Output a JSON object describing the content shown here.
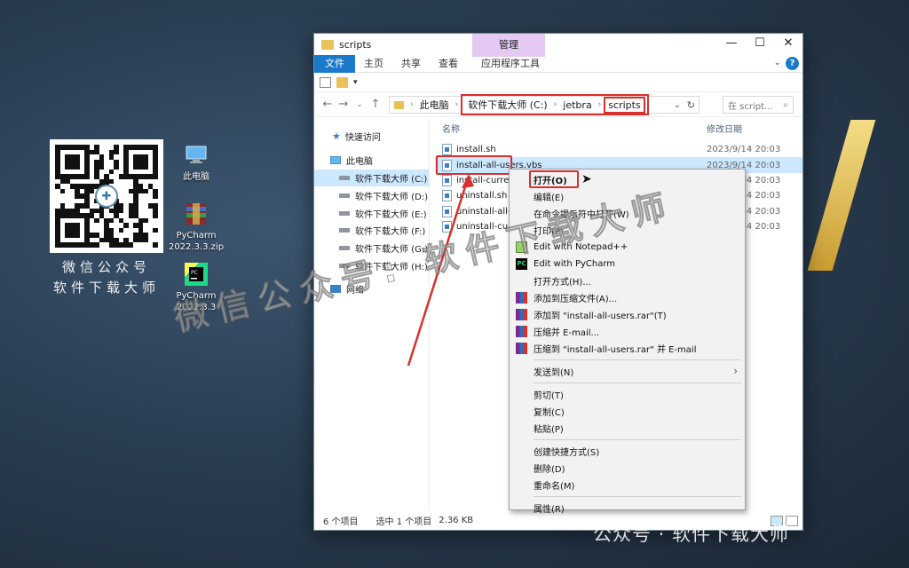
{
  "desktop": {
    "qr_caption_line1": "微信公众号",
    "qr_caption_line2": "软件下载大师",
    "icons": [
      {
        "name": "this-pc",
        "label_line1": "此电脑",
        "label_line2": ""
      },
      {
        "name": "pycharm-zip",
        "label_line1": "PyCharm",
        "label_line2": "2022.3.3.zip"
      },
      {
        "name": "pycharm-app",
        "label_line1": "PyCharm",
        "label_line2": "2022.3.3"
      }
    ],
    "watermark": "微信公众号: 软件下载大师",
    "footer_brand": "公众号 · 软件下载大师"
  },
  "window": {
    "title": "scripts",
    "manage_tab": "管理",
    "controls": {
      "minimize": "—",
      "maximize": "☐",
      "close": "✕"
    },
    "ribbon_tabs": [
      "文件",
      "主页",
      "共享",
      "查看",
      "应用程序工具"
    ],
    "help": "?",
    "breadcrumb": {
      "root": "此电脑",
      "drive": "软件下载大师 (C:)",
      "folder1": "jetbra",
      "folder2": "scripts"
    },
    "search_placeholder": "在 script...",
    "nav": {
      "quick_access": "快速访问",
      "this_pc": "此电脑",
      "drives": [
        "软件下载大师 (C:)",
        "软件下载大师 (D:)",
        "软件下载大师 (E:)",
        "软件下载大师 (F:)",
        "软件下载大师 (G:)",
        "软件下载大师 (H:)"
      ],
      "network": "网络"
    },
    "columns": {
      "name": "名称",
      "date": "修改日期"
    },
    "files": [
      {
        "name": "install.sh",
        "date": "2023/9/14 20:03"
      },
      {
        "name": "install-all-users.vbs",
        "date": "2023/9/14 20:03"
      },
      {
        "name": "install-current-user.vbs",
        "date": "2023/9/14 20:03"
      },
      {
        "name": "uninstall.sh",
        "date": "2023/9/14 20:03"
      },
      {
        "name": "uninstall-all-users.vbs",
        "date": "2023/9/14 20:03"
      },
      {
        "name": "uninstall-current-user.vbs",
        "date": "2023/9/14 20:03"
      }
    ],
    "status": {
      "count": "6 个项目",
      "selected": "选中 1 个项目",
      "size": "2.36 KB"
    }
  },
  "context_menu": {
    "group1": [
      "打开(O)",
      "编辑(E)",
      "在命令提示符中打开(W)",
      "打印(P)"
    ],
    "group2": [
      "Edit with Notepad++",
      "Edit with PyCharm",
      "打开方式(H)..."
    ],
    "group3": [
      "添加到压缩文件(A)...",
      "添加到 \"install-all-users.rar\"(T)",
      "压缩并 E-mail...",
      "压缩到 \"install-all-users.rar\" 并 E-mail"
    ],
    "send_to": "发送到(N)",
    "group4": [
      "剪切(T)",
      "复制(C)",
      "粘贴(P)"
    ],
    "group5": [
      "创建快捷方式(S)",
      "删除(D)",
      "重命名(M)"
    ],
    "properties": "属性(R)"
  },
  "colors": {
    "highlight": "#d9302d",
    "selection": "#cce8ff",
    "file_tab": "#1979ca",
    "manage_tab": "#e4c9f2"
  }
}
